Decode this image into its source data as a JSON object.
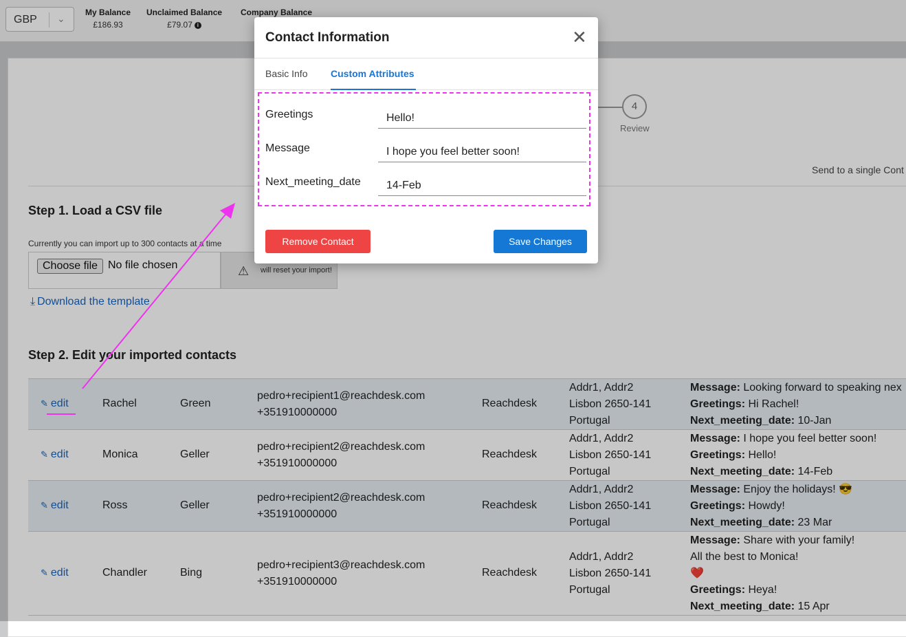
{
  "topbar": {
    "currency": "GBP",
    "my_balance_label": "My Balance",
    "my_balance_value": "£186.93",
    "unclaimed_label": "Unclaimed Balance",
    "unclaimed_value": "£79.07",
    "company_label": "Company Balance"
  },
  "stepper": {
    "step4_number": "4",
    "step4_label": "Review"
  },
  "single_contact_link": "Send to a single Cont",
  "step1": {
    "title": "Step 1. Load a CSV file",
    "note": "Currently you can import up to 300 contacts at a time",
    "choose_file": "Choose file",
    "no_file": "No file chosen",
    "warning": "will reset your import!",
    "download": "Download the template"
  },
  "step2": {
    "title": "Step 2. Edit your imported contacts"
  },
  "table": {
    "edit_label": "edit",
    "rows": [
      {
        "first": "Rachel",
        "last": "Green",
        "email": "pedro+recipient1@reachdesk.com",
        "phone": "+351910000000",
        "company": "Reachdesk",
        "addr1": "Addr1, Addr2",
        "addr2": "Lisbon 2650-141",
        "addr3": "Portugal",
        "msg_label": "Message:",
        "msg": "Looking forward to speaking nex",
        "greet_label": "Greetings:",
        "greet": "Hi Rachel!",
        "date_label": "Next_meeting_date:",
        "date": "10-Jan"
      },
      {
        "first": "Monica",
        "last": "Geller",
        "email": "pedro+recipient2@reachdesk.com",
        "phone": "+351910000000",
        "company": "Reachdesk",
        "addr1": "Addr1, Addr2",
        "addr2": "Lisbon 2650-141",
        "addr3": "Portugal",
        "msg_label": "Message:",
        "msg": "I hope you feel better soon!",
        "greet_label": "Greetings:",
        "greet": "Hello!",
        "date_label": "Next_meeting_date:",
        "date": "14-Feb"
      },
      {
        "first": "Ross",
        "last": "Geller",
        "email": "pedro+recipient2@reachdesk.com",
        "phone": "+351910000000",
        "company": "Reachdesk",
        "addr1": "Addr1, Addr2",
        "addr2": "Lisbon 2650-141",
        "addr3": "Portugal",
        "msg_label": "Message:",
        "msg": "Enjoy the holidays! 😎",
        "greet_label": "Greetings:",
        "greet": "Howdy!",
        "date_label": "Next_meeting_date:",
        "date": "23 Mar"
      },
      {
        "first": "Chandler",
        "last": "Bing",
        "email": "pedro+recipient3@reachdesk.com",
        "phone": "+351910000000",
        "company": "Reachdesk",
        "addr1": "Addr1, Addr2",
        "addr2": "Lisbon 2650-141",
        "addr3": "Portugal",
        "msg_label": "Message:",
        "msg": "Share with your family!",
        "msg_line2": "All the best to Monica!",
        "msg_line3": "❤️",
        "greet_label": "Greetings:",
        "greet": "Heya!",
        "date_label": "Next_meeting_date:",
        "date": "15 Apr"
      }
    ]
  },
  "modal": {
    "title": "Contact Information",
    "close": "✕",
    "tabs": [
      "Basic Info",
      "Custom Attributes"
    ],
    "attributes": [
      {
        "label": "Greetings",
        "value": "Hello!"
      },
      {
        "label": "Message",
        "value": "I hope you feel better soon!"
      },
      {
        "label": "Next_meeting_date",
        "value": "14-Feb"
      }
    ],
    "remove_button": "Remove Contact",
    "save_button": "Save Changes"
  },
  "colors": {
    "accent": "#1478d4",
    "danger": "#ef4444",
    "annotation": "#ee33ee"
  }
}
